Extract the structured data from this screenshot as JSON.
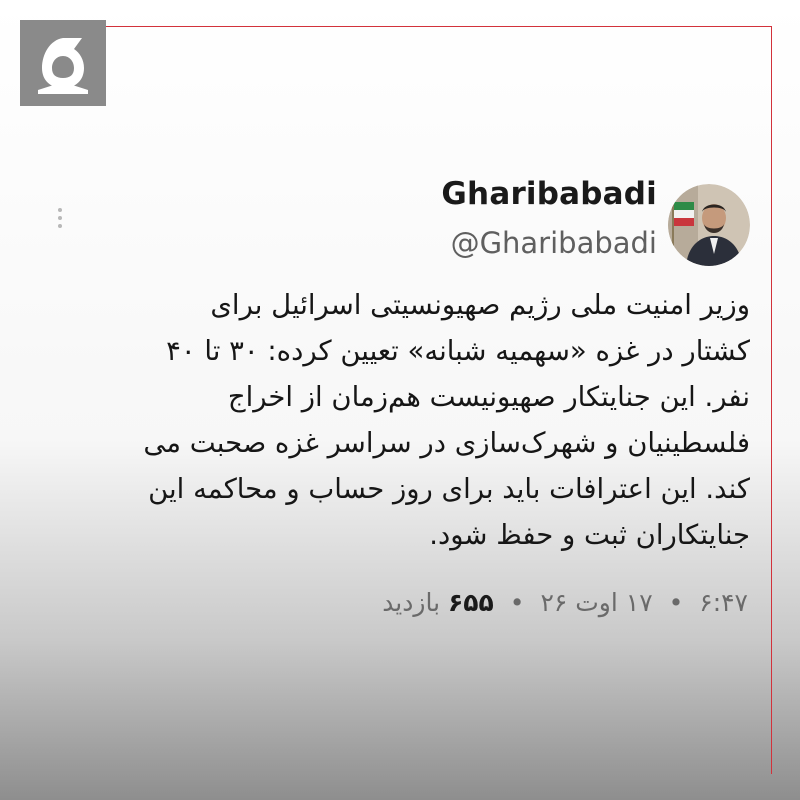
{
  "channel_logo": {
    "icon": "channel-logo-icon",
    "color": "#8a8a8a"
  },
  "profile": {
    "display_name": "Gharibabadi",
    "handle": "@Gharibabadi",
    "avatar": "profile-photo"
  },
  "menu": {
    "icon": "more-vertical-icon"
  },
  "tweet": {
    "lines": [
      "وزیر امنیت ملی رژیم صهیونسیتی اسرائیل برای",
      "کشتار در غزه «سهمیه شبانه» تعیین کرده: ۳۰ تا ۴۰",
      "نفر. این جنایتکار صهیونیست هم‌زمان از اخراج",
      "فلسطینیان و شهرک‌سازی در سراسر غزه صحبت می",
      "کند. این اعترافات باید برای روز حساب و محاکمه این",
      "جنایتکاران ثبت و حفظ شود."
    ]
  },
  "meta": {
    "time": "۶:۴۷",
    "separator": "•",
    "date": "۱۷ اوت ۲۶",
    "views_count": "۶۵۵",
    "views_label": "بازدید"
  },
  "colors": {
    "frame_accent": "#d2323b",
    "text": "#161616",
    "muted": "#6a6a6a"
  }
}
